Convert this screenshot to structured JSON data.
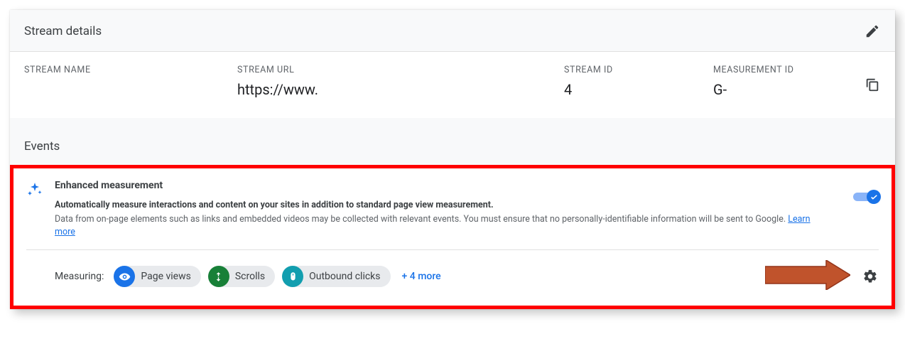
{
  "stream_details": {
    "section_title": "Stream details",
    "name_label": "STREAM NAME",
    "name_value": "",
    "url_label": "STREAM URL",
    "url_value": "https://www.",
    "id_label": "STREAM ID",
    "id_value": "4",
    "mid_label": "MEASUREMENT ID",
    "mid_value": "G-"
  },
  "events": {
    "section_title": "Events",
    "enhanced": {
      "title": "Enhanced measurement",
      "subtitle": "Automatically measure interactions and content on your sites in addition to standard page view measurement.",
      "description_prefix": "Data from on-page elements such as links and embedded videos may be collected with relevant events. You must ensure that no personally-identifiable information will be sent to Google. ",
      "learn_more": "Learn more",
      "toggle_on": true
    },
    "measuring": {
      "label": "Measuring:",
      "chips": [
        {
          "label": "Page views",
          "color": "blue",
          "icon": "eye"
        },
        {
          "label": "Scrolls",
          "color": "green",
          "icon": "diamond"
        },
        {
          "label": "Outbound clicks",
          "color": "teal",
          "icon": "mouse"
        }
      ],
      "more": "+ 4 more"
    }
  }
}
